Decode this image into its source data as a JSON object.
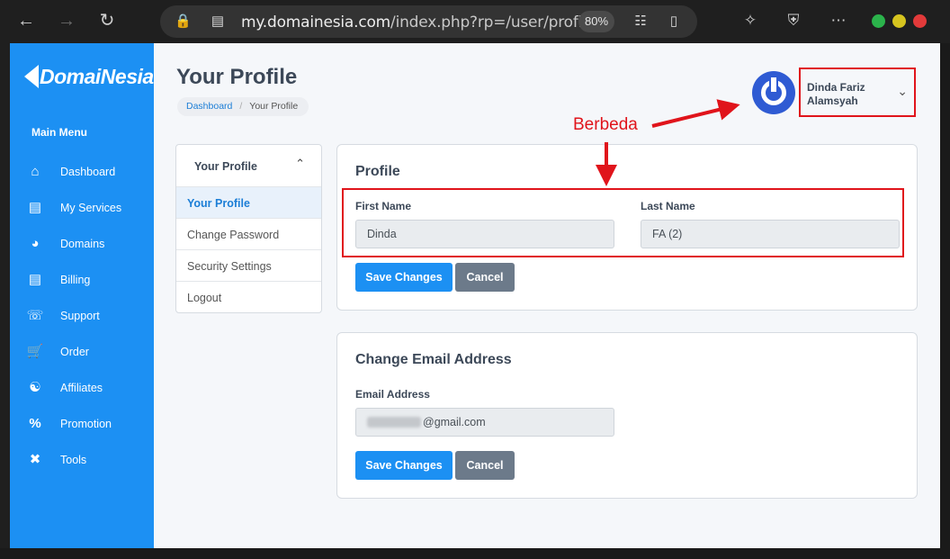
{
  "browser": {
    "url_host": "my.domainesia.com",
    "url_path": "/index.php?rp=/user/profile",
    "zoom": "80%"
  },
  "sidebar": {
    "brand": "DomaiNesia",
    "menu_title": "Main Menu",
    "items": [
      {
        "label": "Dashboard",
        "icon": "home-icon"
      },
      {
        "label": "My Services",
        "icon": "server-icon"
      },
      {
        "label": "Domains",
        "icon": "globe-icon"
      },
      {
        "label": "Billing",
        "icon": "receipt-icon"
      },
      {
        "label": "Support",
        "icon": "headset-icon"
      },
      {
        "label": "Order",
        "icon": "cart-icon"
      },
      {
        "label": "Affiliates",
        "icon": "handshake-icon"
      },
      {
        "label": "Promotion",
        "icon": "percent-icon"
      },
      {
        "label": "Tools",
        "icon": "tools-icon"
      }
    ]
  },
  "header": {
    "title": "Your Profile",
    "breadcrumb": {
      "home": "Dashboard",
      "current": "Your Profile"
    },
    "user_name": "Dinda Fariz Alamsyah"
  },
  "subnav": {
    "title": "Your Profile",
    "items": [
      "Your Profile",
      "Change Password",
      "Security Settings",
      "Logout"
    ]
  },
  "profile_card": {
    "title": "Profile",
    "first_name_label": "First Name",
    "first_name_value": "Dinda",
    "last_name_label": "Last Name",
    "last_name_value": "FA (2)",
    "save_label": "Save Changes",
    "cancel_label": "Cancel"
  },
  "email_card": {
    "title": "Change Email Address",
    "email_label": "Email Address",
    "email_suffix": "@gmail.com",
    "save_label": "Save Changes",
    "cancel_label": "Cancel"
  },
  "annotation": {
    "text": "Berbeda",
    "color": "#e0141b"
  },
  "colors": {
    "sidebar": "#1c90f3",
    "primary_button": "#1c90f3",
    "secondary_button": "#6c7a8a",
    "avatar": "#2f5bd3"
  }
}
